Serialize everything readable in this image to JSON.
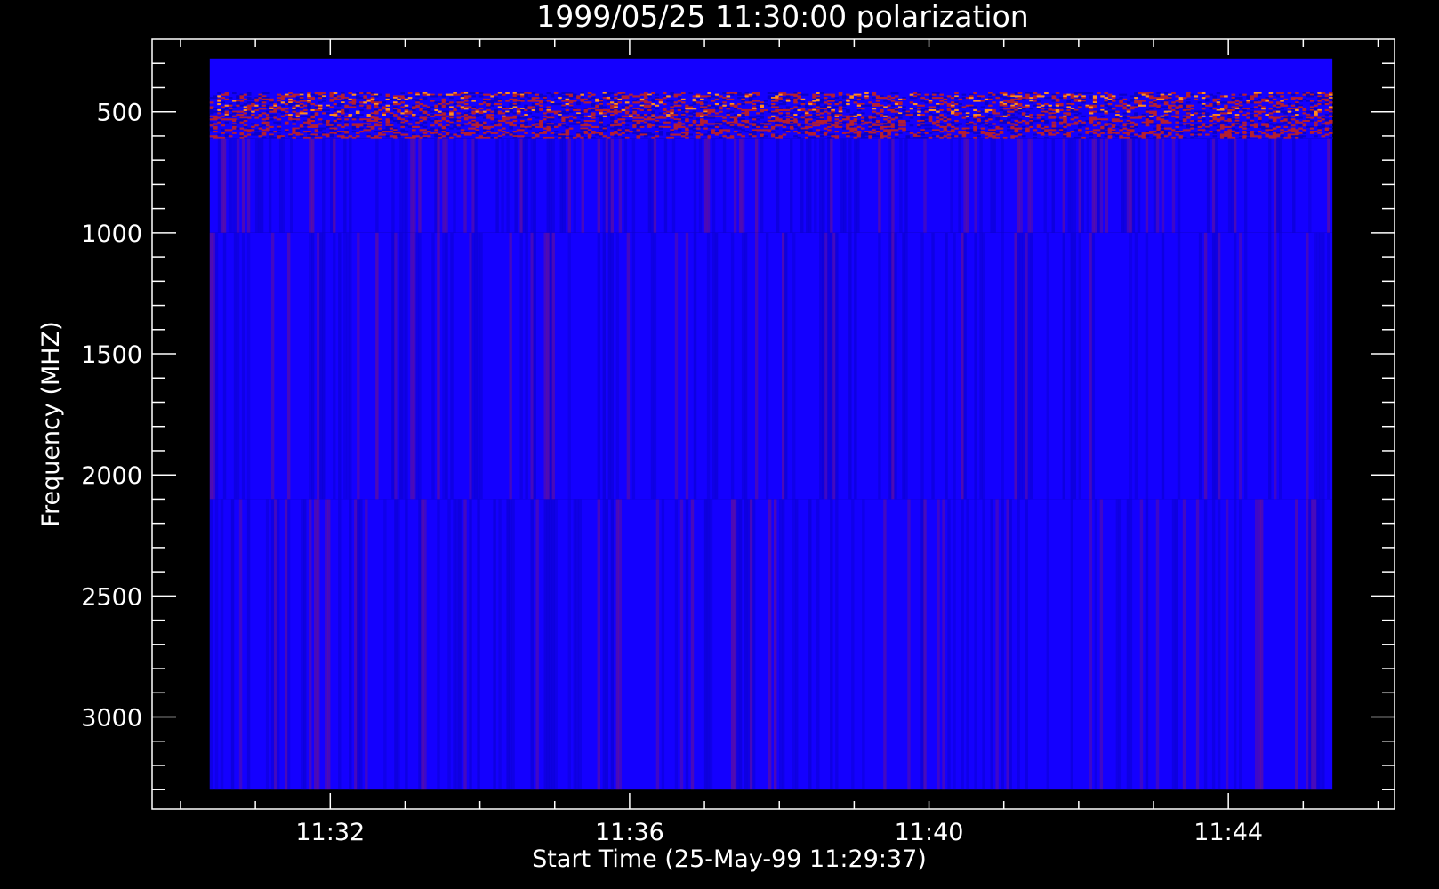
{
  "chart_data": {
    "type": "heatmap",
    "title": "1999/05/25 11:30:00 polarization",
    "xlabel": "Start Time (25-May-99 11:29:37)",
    "ylabel": "Frequency (MHZ)",
    "x_ticks": [
      "11:32",
      "11:36",
      "11:40",
      "11:44"
    ],
    "x_tick_minutes": [
      2.38,
      6.38,
      10.38,
      14.38
    ],
    "y_ticks": [
      500,
      1000,
      1500,
      2000,
      2500,
      3000
    ],
    "xlim_minutes": [
      0,
      16.6
    ],
    "ylim": [
      200,
      3380
    ],
    "data_extent": {
      "time_minutes": [
        0.77,
        15.77
      ],
      "frequency_mhz": [
        280,
        3300
      ]
    },
    "y_reversed": true,
    "grid": false,
    "colormap": [
      "#0a00c8",
      "#1400ff",
      "#b41e32",
      "#ff8c1e"
    ],
    "bands": [
      {
        "from_mhz": 280,
        "to_mhz": 420,
        "pattern": "uniform"
      },
      {
        "from_mhz": 420,
        "to_mhz": 610,
        "pattern": "noisy"
      },
      {
        "from_mhz": 610,
        "to_mhz": 1000,
        "pattern": "striped"
      },
      {
        "from_mhz": 1000,
        "to_mhz": 2100,
        "pattern": "striped"
      },
      {
        "from_mhz": 2100,
        "to_mhz": 3300,
        "pattern": "striped"
      }
    ]
  }
}
